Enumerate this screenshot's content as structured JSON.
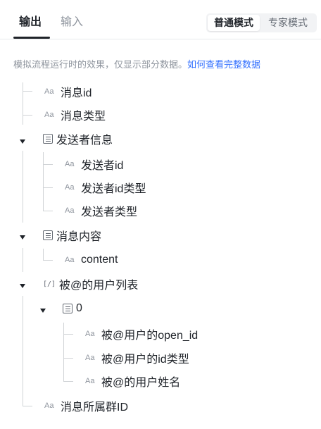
{
  "tabs": {
    "output": "输出",
    "input": "输入"
  },
  "mode": {
    "normal": "普通模式",
    "expert": "专家模式"
  },
  "hint": {
    "text": "模拟流程运行时的效果，仅显示部分数据。",
    "link": "如何查看完整数据"
  },
  "icons": {
    "text_field": "text-type-icon",
    "object_field": "object-type-icon",
    "array_field": "array-type-icon",
    "expand": "caret-down-icon"
  },
  "tree": {
    "message_id": {
      "label": "消息id",
      "type": "text"
    },
    "message_type": {
      "label": "消息类型",
      "type": "text"
    },
    "sender_info": {
      "label": "发送者信息",
      "type": "object",
      "children": {
        "sender_id": {
          "label": "发送者id",
          "type": "text"
        },
        "sender_id_type": {
          "label": "发送者id类型",
          "type": "text"
        },
        "sender_type": {
          "label": "发送者类型",
          "type": "text"
        }
      }
    },
    "message_content": {
      "label": "消息内容",
      "type": "object",
      "children": {
        "content": {
          "label": "content",
          "type": "text"
        }
      }
    },
    "mentioned_users": {
      "label": "被@的用户列表",
      "type": "array",
      "children": {
        "item0": {
          "label": "0",
          "type": "object",
          "children": {
            "open_id": {
              "label": "被@用户的open_id",
              "type": "text"
            },
            "id_type": {
              "label": "被@用户的id类型",
              "type": "text"
            },
            "name": {
              "label": "被@的用户姓名",
              "type": "text"
            }
          }
        }
      }
    },
    "chat_id": {
      "label": "消息所属群ID",
      "type": "text"
    }
  }
}
